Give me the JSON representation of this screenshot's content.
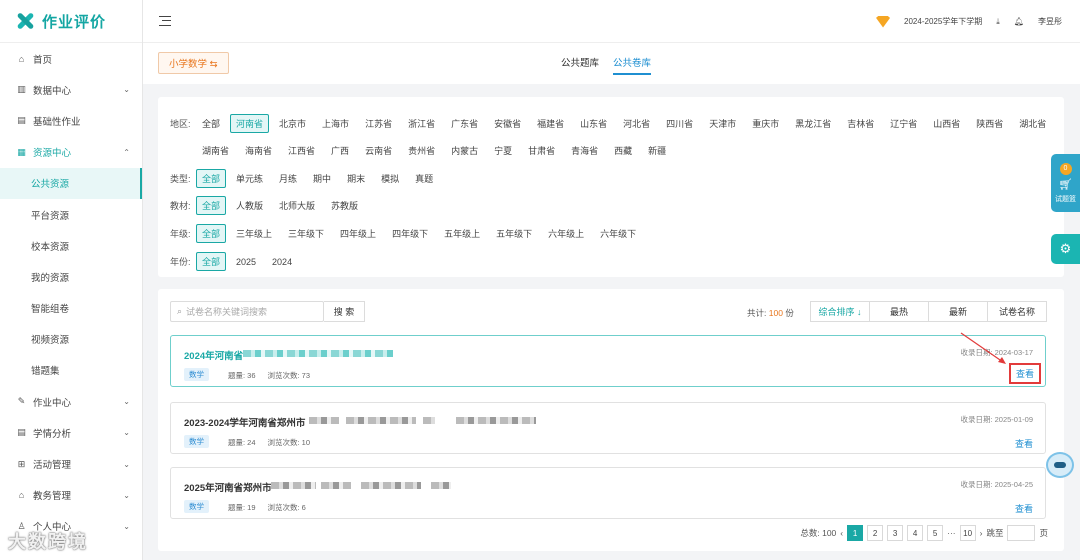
{
  "app": {
    "title": "作业评价"
  },
  "sidebar": {
    "items": [
      {
        "label": "首页",
        "icon": "home-icon",
        "glyph": "⌂",
        "sub": false,
        "chevron": ""
      },
      {
        "label": "数据中心",
        "icon": "chart-icon",
        "glyph": "▥",
        "sub": false,
        "chevron": "⌄"
      },
      {
        "label": "基础性作业",
        "icon": "document-icon",
        "glyph": "▤",
        "sub": false,
        "chevron": ""
      },
      {
        "label": "资源中心",
        "icon": "grid-icon",
        "glyph": "▦",
        "sub": false,
        "chevron": "⌃",
        "open": true
      },
      {
        "label": "公共资源",
        "sub": true,
        "active": true
      },
      {
        "label": "平台资源",
        "sub": true
      },
      {
        "label": "校本资源",
        "sub": true
      },
      {
        "label": "我的资源",
        "sub": true
      },
      {
        "label": "智能组卷",
        "sub": true
      },
      {
        "label": "视频资源",
        "sub": true
      },
      {
        "label": "错题集",
        "sub": true
      },
      {
        "label": "作业中心",
        "icon": "edit-icon",
        "glyph": "✎",
        "sub": false,
        "chevron": "⌄"
      },
      {
        "label": "学情分析",
        "icon": "analysis-icon",
        "glyph": "▤",
        "sub": false,
        "chevron": "⌄"
      },
      {
        "label": "活动管理",
        "icon": "activity-icon",
        "glyph": "⊞",
        "sub": false,
        "chevron": "⌄"
      },
      {
        "label": "教务管理",
        "icon": "school-icon",
        "glyph": "⌂",
        "sub": false,
        "chevron": "⌄"
      },
      {
        "label": "个人中心",
        "icon": "user-icon",
        "glyph": "♙",
        "sub": false,
        "chevron": "⌄"
      }
    ]
  },
  "topbar": {
    "term": "2024-2025学年下学期",
    "user": "李昱彤"
  },
  "subject": {
    "label": "小学数学 ⇆"
  },
  "library_tabs": [
    {
      "label": "公共题库",
      "active": false
    },
    {
      "label": "公共卷库",
      "active": true
    }
  ],
  "filters": [
    {
      "label": "地区:",
      "options": [
        "全部",
        "河南省",
        "北京市",
        "上海市",
        "江苏省",
        "浙江省",
        "广东省",
        "安徽省",
        "福建省",
        "山东省",
        "河北省",
        "四川省",
        "天津市",
        "重庆市",
        "黑龙江省",
        "吉林省",
        "辽宁省",
        "山西省",
        "陕西省",
        "湖北省"
      ],
      "selected": 1
    },
    {
      "label": "",
      "options": [
        "湖南省",
        "海南省",
        "江西省",
        "广西",
        "云南省",
        "贵州省",
        "内蒙古",
        "宁夏",
        "甘肃省",
        "青海省",
        "西藏",
        "新疆"
      ],
      "selected": -1
    },
    {
      "label": "类型:",
      "options": [
        "全部",
        "单元练",
        "月练",
        "期中",
        "期末",
        "模拟",
        "真题"
      ],
      "selected": 0
    },
    {
      "label": "教材:",
      "options": [
        "全部",
        "人教版",
        "北师大版",
        "苏教版"
      ],
      "selected": 0
    },
    {
      "label": "年级:",
      "options": [
        "全部",
        "三年级上",
        "三年级下",
        "四年级上",
        "四年级下",
        "五年级上",
        "五年级下",
        "六年级上",
        "六年级下"
      ],
      "selected": 0
    },
    {
      "label": "年份:",
      "options": [
        "全部",
        "2025",
        "2024"
      ],
      "selected": 0
    }
  ],
  "search": {
    "placeholder": "试卷名称关键词搜索",
    "button": "搜 索"
  },
  "total": {
    "prefix": "共计:",
    "count": "100",
    "unit": "份"
  },
  "sorts": [
    {
      "label": "综合排序 ↓",
      "selected": true
    },
    {
      "label": "最热",
      "selected": false
    },
    {
      "label": "最新",
      "selected": false
    },
    {
      "label": "试卷名称",
      "selected": false
    }
  ],
  "papers": [
    {
      "title": "2024年河南省",
      "subject": "数学",
      "questions": "题量: 36",
      "views": "浏览次数: 73",
      "date": "收录日期: 2024-03-17",
      "view": "查看",
      "highlight": true
    },
    {
      "title": "2023-2024学年河南省郑州市",
      "subject": "数学",
      "questions": "题量: 24",
      "views": "浏览次数: 10",
      "date": "收录日期: 2025-01-09",
      "view": "查看",
      "highlight": false
    },
    {
      "title": "2025年河南省郑州市",
      "subject": "数学",
      "questions": "题量: 19",
      "views": "浏览次数: 6",
      "date": "收录日期: 2025-04-25",
      "view": "查看",
      "highlight": false
    }
  ],
  "pagination": {
    "total": "总数: 100",
    "pages": [
      "1",
      "2",
      "3",
      "4",
      "5"
    ],
    "ellipsis": "···",
    "last": "10",
    "goto": "跳至",
    "page_unit": "页",
    "current": "1"
  },
  "float": {
    "cart_count": "0",
    "cart_label": "试题篮"
  },
  "watermark": "大数跨境",
  "colors": {
    "accent": "#1aa8a5",
    "link": "#1f8fd1",
    "orange": "#e8761d",
    "annotation": "#e23b3b"
  }
}
